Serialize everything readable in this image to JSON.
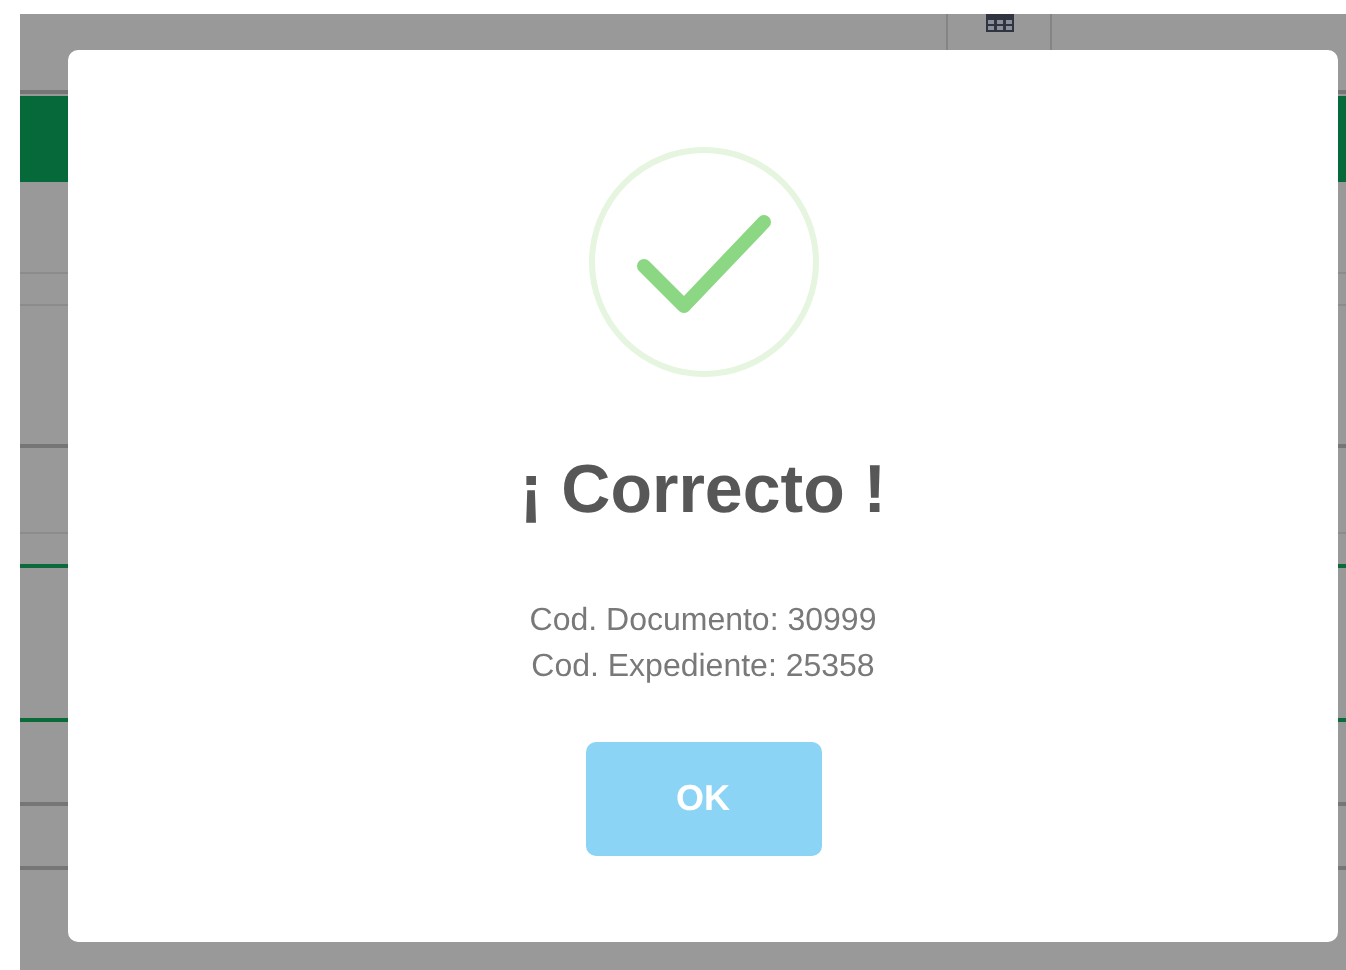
{
  "dialog": {
    "kind": "success",
    "title": "¡ Correcto !",
    "message": [
      "Cod. Documento: 30999",
      "Cod. Expediente: 25358"
    ],
    "button": {
      "label": "OK"
    }
  }
}
